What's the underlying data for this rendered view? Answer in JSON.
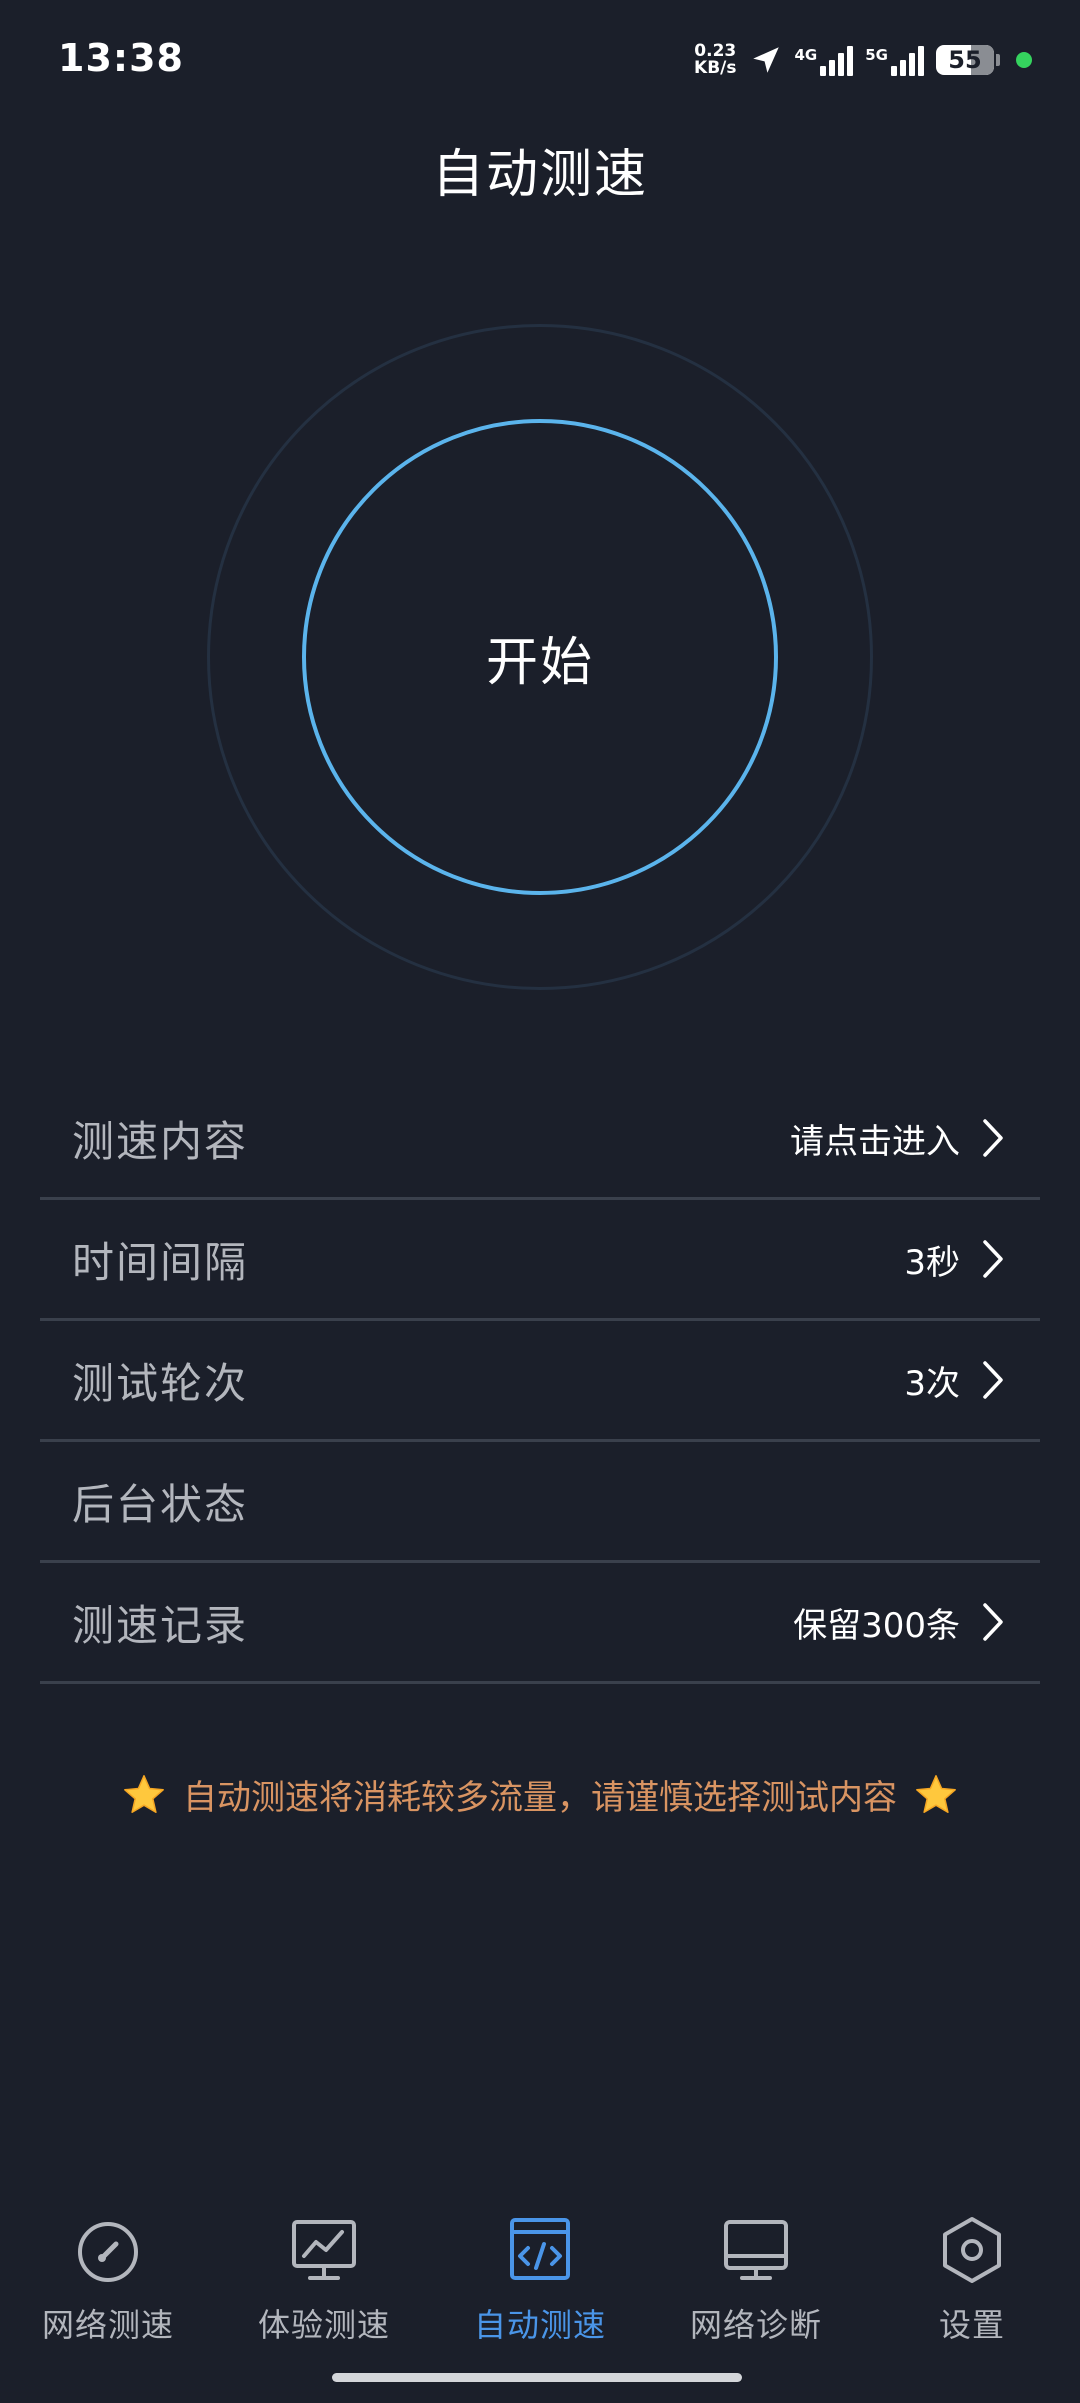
{
  "status_bar": {
    "time": "13:38",
    "net_speed_value": "0.23",
    "net_speed_unit": "KB/s",
    "signal_1_tag": "4G",
    "signal_2_tag": "5G",
    "battery": "55"
  },
  "header": {
    "title": "自动测速"
  },
  "start_button": {
    "label": "开始"
  },
  "settings": {
    "rows": [
      {
        "label": "测速内容",
        "value": "请点击进入"
      },
      {
        "label": "时间间隔",
        "value": "3秒"
      },
      {
        "label": "测试轮次",
        "value": "3次"
      },
      {
        "label": "后台状态",
        "value": ""
      },
      {
        "label": "测速记录",
        "value": "保留300条"
      }
    ]
  },
  "notice": {
    "text": "自动测速将消耗较多流量，请谨慎选择测试内容",
    "icon": "star-icon",
    "color": "#d99462"
  },
  "bottom_nav": {
    "items": [
      {
        "label": "网络测速",
        "icon": "speedometer-icon"
      },
      {
        "label": "体验测速",
        "icon": "trend-chart-icon"
      },
      {
        "label": "自动测速",
        "icon": "code-window-icon",
        "active": true
      },
      {
        "label": "网络诊断",
        "icon": "monitor-icon"
      },
      {
        "label": "设置",
        "icon": "hexagon-settings-icon"
      }
    ],
    "active_color": "#4a95e8"
  },
  "colors": {
    "background": "#1b1f2a",
    "accent_ring": "#5bb4ec",
    "divider": "#3a404c"
  }
}
